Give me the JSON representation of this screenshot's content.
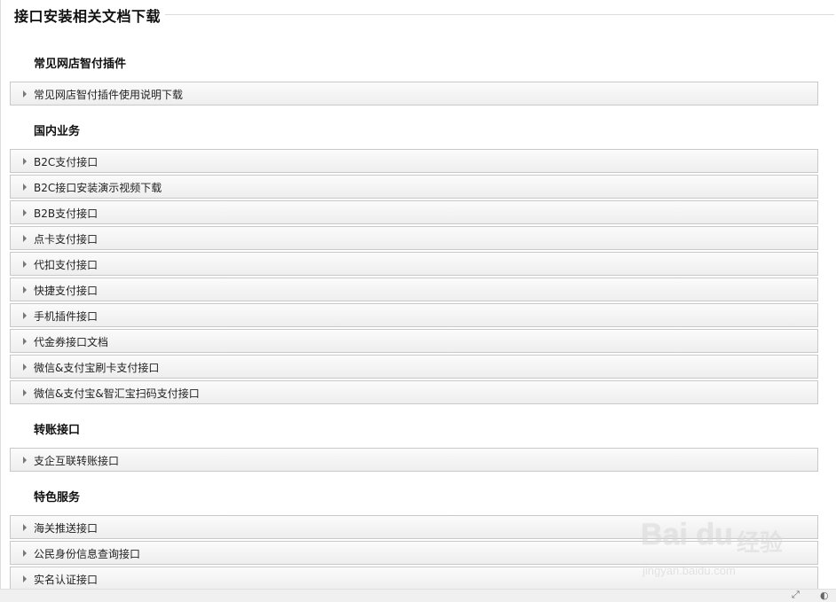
{
  "page_title": "接口安装相关文档下载",
  "sections": [
    {
      "heading": "常见网店智付插件",
      "items": [
        "常见网店智付插件使用说明下载"
      ]
    },
    {
      "heading": "国内业务",
      "items": [
        "B2C支付接口",
        "B2C接口安装演示视频下载",
        "B2B支付接口",
        "点卡支付接口",
        "代扣支付接口",
        "快捷支付接口",
        "手机插件接口",
        "代金券接口文档",
        "微信&支付宝刷卡支付接口",
        "微信&支付宝&智汇宝扫码支付接口"
      ]
    },
    {
      "heading": "转账接口",
      "items": [
        "支企互联转账接口"
      ]
    },
    {
      "heading": "特色服务",
      "items": [
        "海关推送接口",
        "公民身份信息查询接口",
        "实名认证接口"
      ]
    }
  ],
  "watermark": {
    "brand": "Bai du",
    "cn": "经验",
    "url": "jingyan.baidu.com"
  }
}
